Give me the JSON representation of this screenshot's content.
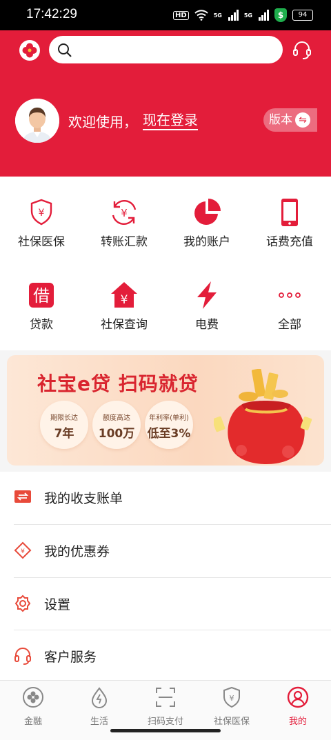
{
  "status_bar": {
    "time": "17:42:29",
    "hd": "HD",
    "signal_1": "5G",
    "signal_2": "5G",
    "battery": "94"
  },
  "header": {
    "welcome": "欢迎使用，",
    "login": "现在登录",
    "version": "版本",
    "search_placeholder": "",
    "colors": {
      "brand": "#e31d3a"
    }
  },
  "grid": {
    "items": [
      {
        "label": "社保医保",
        "icon": "shield-yuan-icon"
      },
      {
        "label": "转账汇款",
        "icon": "transfer-icon"
      },
      {
        "label": "我的账户",
        "icon": "pie-chart-icon"
      },
      {
        "label": "话费充值",
        "icon": "phone-icon"
      },
      {
        "label": "贷款",
        "icon": "loan-icon"
      },
      {
        "label": "社保查询",
        "icon": "house-yuan-icon"
      },
      {
        "label": "电费",
        "icon": "lightning-icon"
      },
      {
        "label": "全部",
        "icon": "more-dots-icon"
      }
    ],
    "loan_glyph": "借",
    "yuan_glyph": "¥"
  },
  "banner": {
    "title": "社宝e贷 扫码就贷",
    "bubbles": [
      {
        "top": "期限长达",
        "value": "7年"
      },
      {
        "top": "额度高达",
        "value": "100万"
      },
      {
        "top": "年利率(单利)",
        "value": "低至3%"
      }
    ]
  },
  "menu": {
    "items": [
      {
        "label": "我的收支账单",
        "icon": "bill-icon"
      },
      {
        "label": "我的优惠券",
        "icon": "coupon-icon"
      },
      {
        "label": "设置",
        "icon": "settings-gear-icon"
      },
      {
        "label": "客户服务",
        "icon": "headset-icon"
      }
    ]
  },
  "tabbar": {
    "tabs": [
      {
        "label": "金融",
        "icon": "finance-icon"
      },
      {
        "label": "生活",
        "icon": "life-icon"
      },
      {
        "label": "扫码支付",
        "icon": "scan-icon"
      },
      {
        "label": "社保医保",
        "icon": "shield-yuan-icon"
      },
      {
        "label": "我的",
        "icon": "profile-icon",
        "active": true
      }
    ]
  }
}
